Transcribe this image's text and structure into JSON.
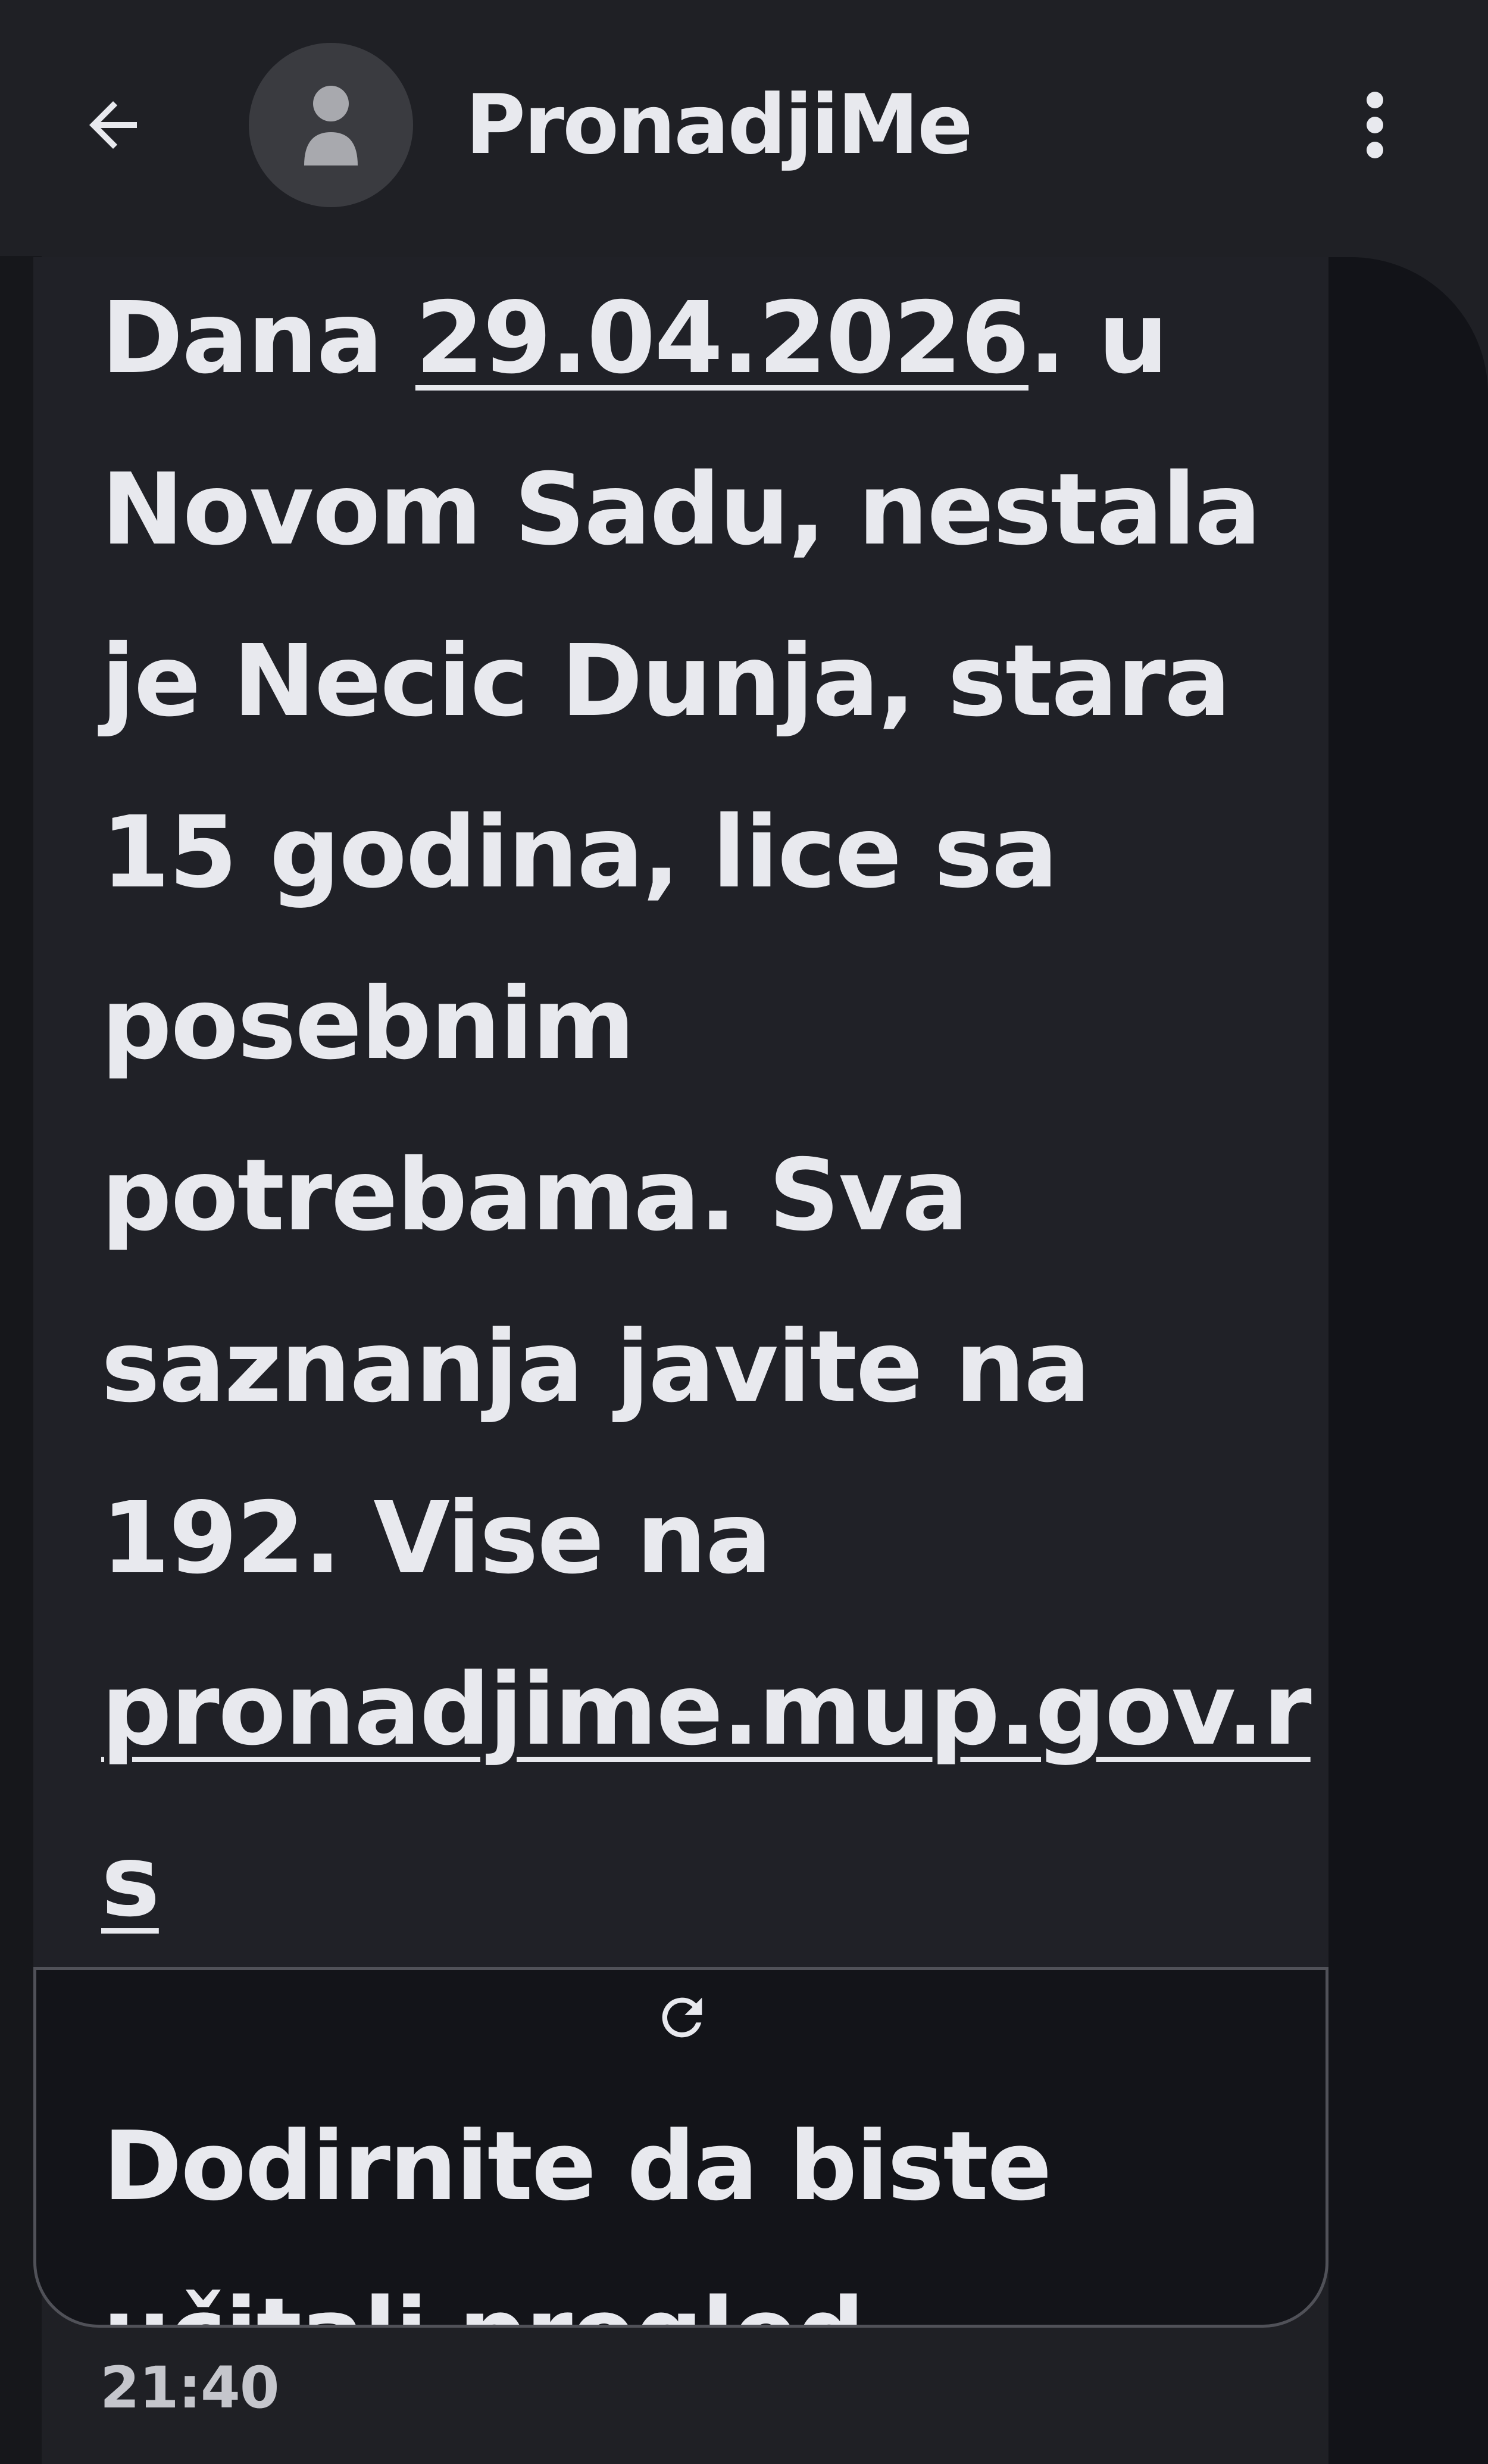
{
  "header": {
    "back_icon": "arrow-left-icon",
    "avatar_icon": "person-icon",
    "contact_name": "PronadjiMe",
    "menu_icon": "more-vert-icon"
  },
  "message": {
    "part1": "Dana ",
    "date_link": "29.04.2026",
    "part2": ". u Novom Sadu, nestala je Necic Dunja, stara 15 godina, lice sa posebnim potrebama. Sva saznanja javite na 192. Vise na ",
    "url_link_a": "pronadjime.mup.gov.r",
    "url_link_b": "s",
    "time": "21:40"
  },
  "link_preview": {
    "reload_icon": "refresh-icon",
    "text_line1": "Dodirnite da biste",
    "text_line2": "učitali pregled"
  },
  "colors": {
    "background": "#1f2025",
    "bubble": "#202127",
    "preview_bg": "#131419",
    "text": "#e8e9ee"
  }
}
